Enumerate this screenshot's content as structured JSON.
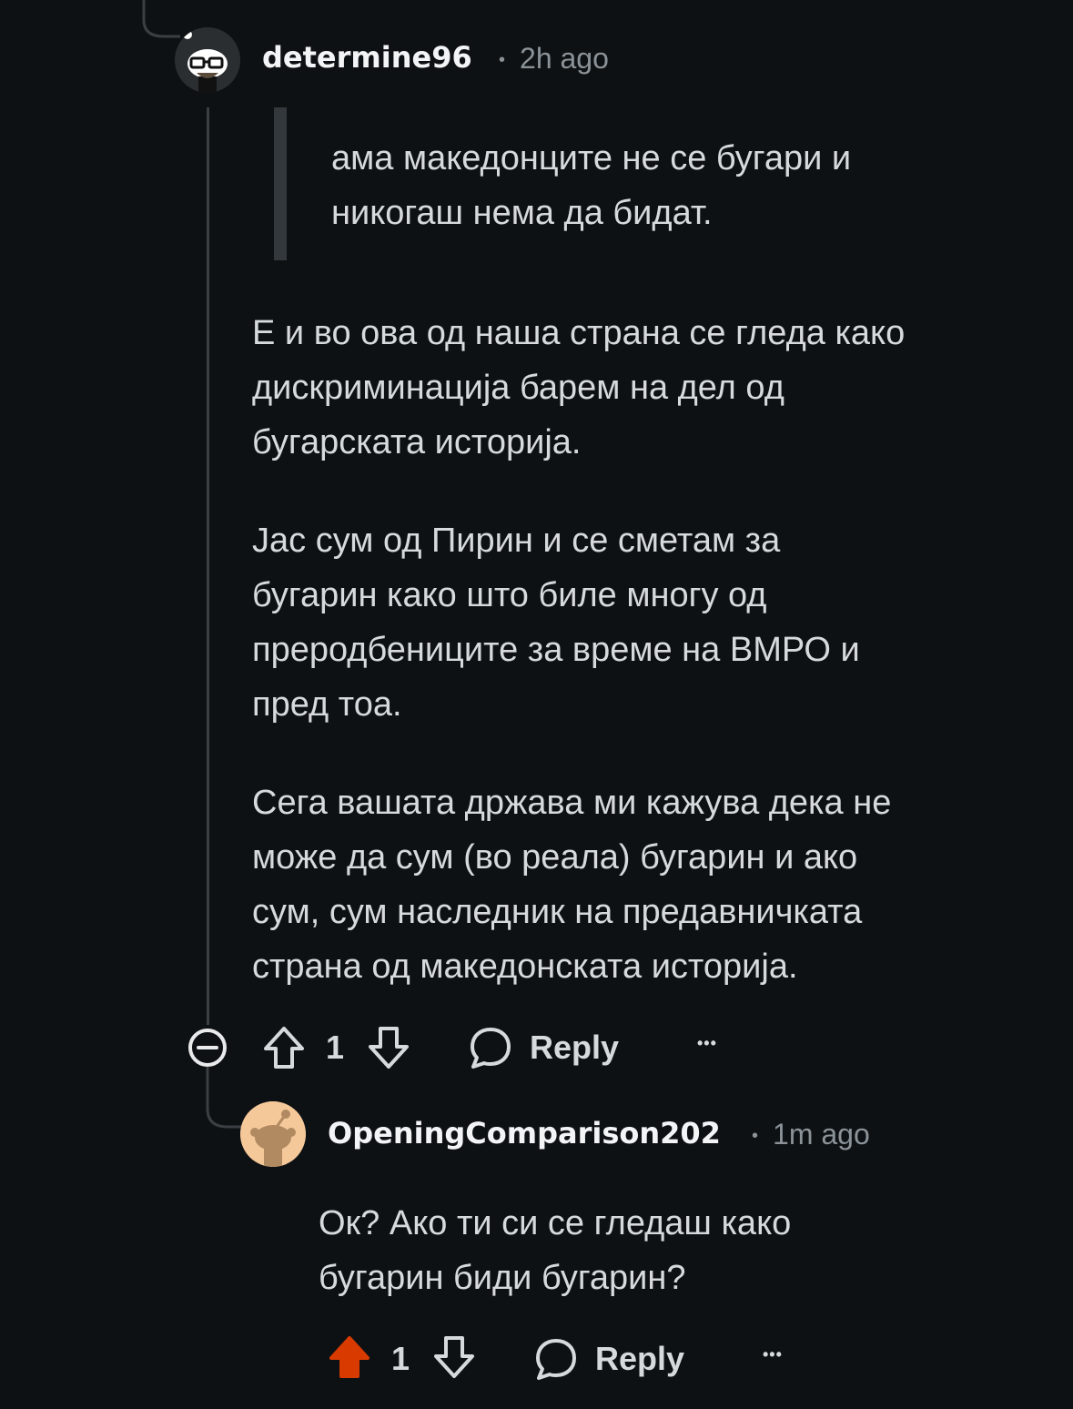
{
  "comment_1": {
    "username": "determine96",
    "separator": "•",
    "time": "2h ago",
    "quote": "ама македонците не се бугари и\nникогаш нема да бидат.",
    "paragraphs": [
      "Е и во ова од наша страна се гледа како\nдискриминација барем на дел од\nбугарската историја.",
      "Јас сум од Пирин и се сметам за\nбугарин како што биле многу од\nпреродбениците за време на ВМРО и\nпред тоа.",
      "Сега вашата држава ми кажува дека не\nможе да сум (во реала) бугарин и ако\nсум, сум наследник на предавничката\nстрана од македонската историја."
    ],
    "actions": {
      "collapse_icon": "collapse-minus-icon",
      "upvote_icon": "upvote-arrow-icon",
      "vote_count": "1",
      "downvote_icon": "downvote-arrow-icon",
      "reply_icon": "speech-bubble-icon",
      "reply_label": "Reply",
      "more_label": "•••"
    }
  },
  "comment_2": {
    "username": "OpeningComparison202",
    "separator": "•",
    "time": "1m ago",
    "paragraphs": [
      "Ок? Ако ти си се гледаш како\nбугарин биди бугарин?"
    ],
    "actions": {
      "upvote_icon": "upvote-arrow-filled-icon",
      "upvote_color": "#d93a00",
      "vote_count": "1",
      "downvote_icon": "downvote-arrow-icon",
      "reply_icon": "speech-bubble-icon",
      "reply_label": "Reply",
      "more_label": "•••"
    }
  },
  "colors": {
    "background": "#0e1113",
    "text": "#d7dadc",
    "meta": "#8b9399",
    "thread_line": "#3a3f44",
    "upvoted": "#d93a00"
  }
}
